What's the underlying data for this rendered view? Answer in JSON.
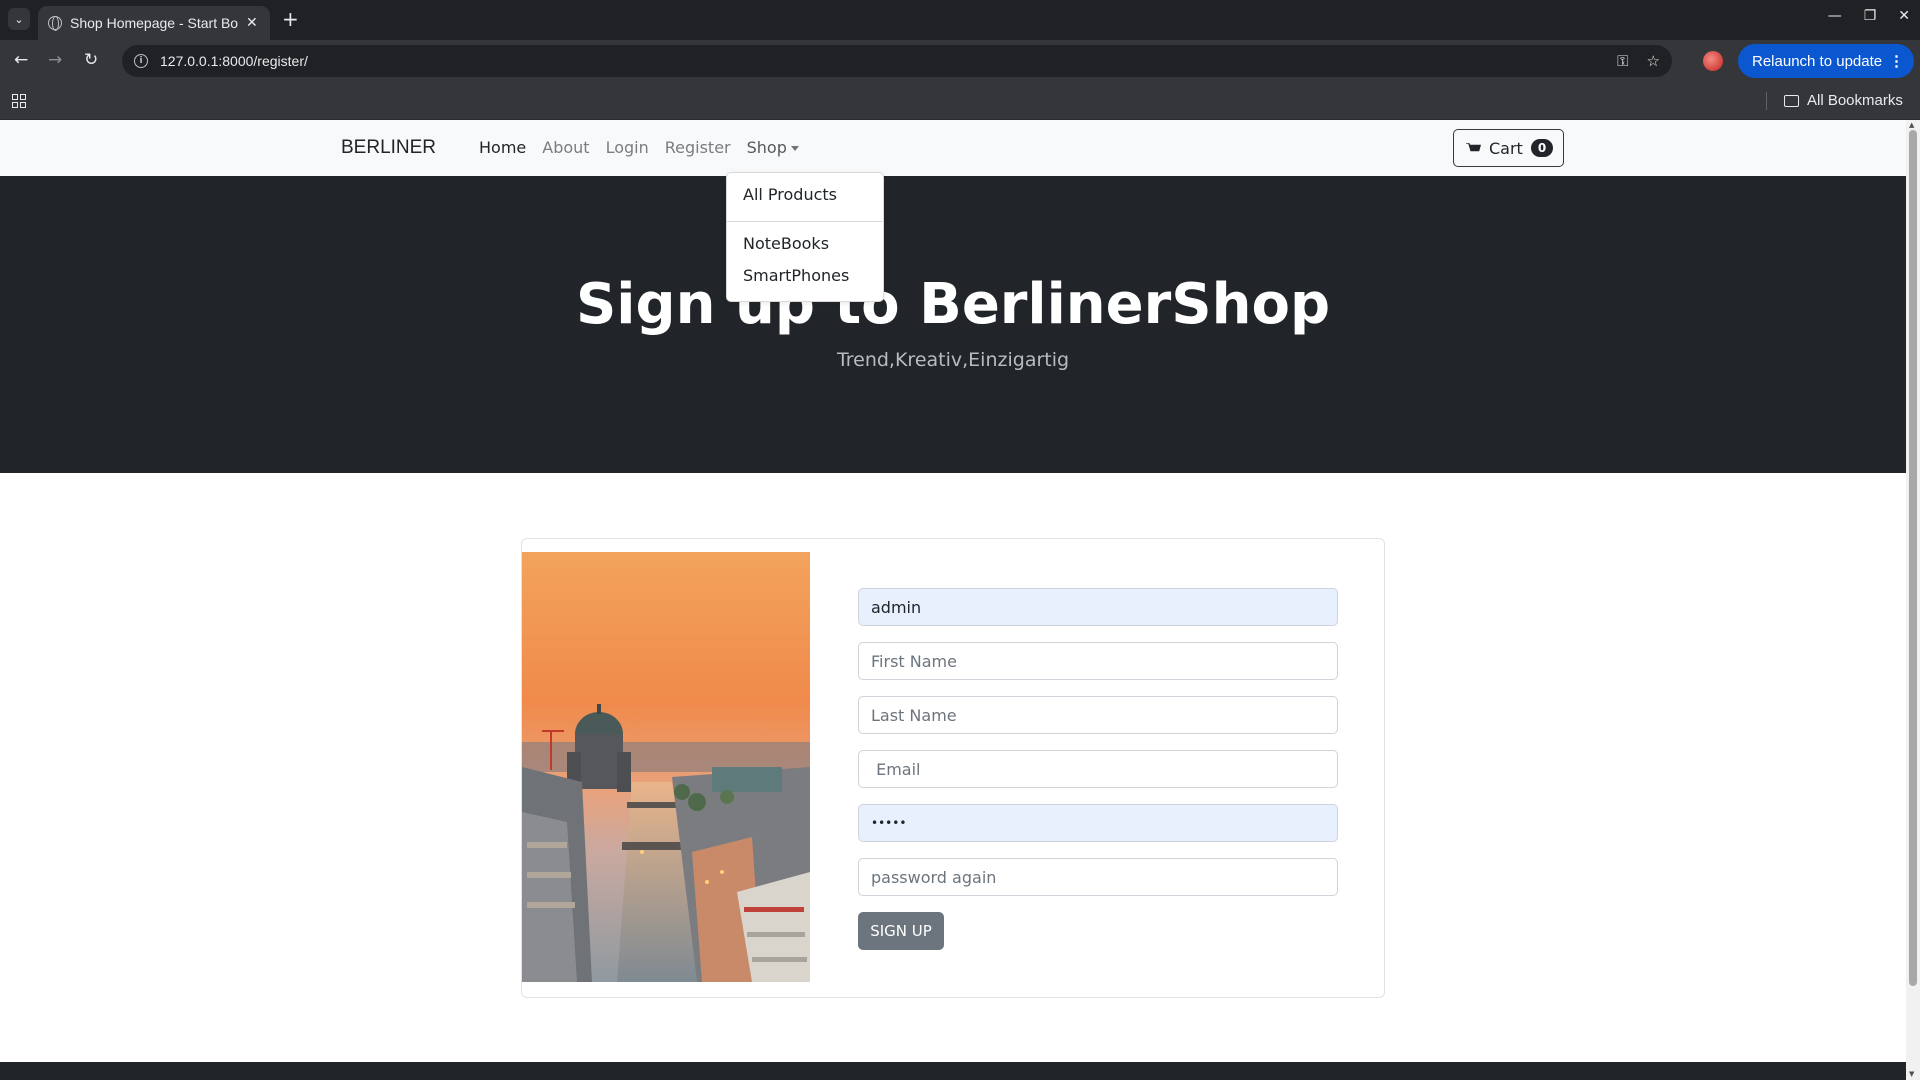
{
  "browser": {
    "tab_title": "Shop Homepage - Start Bootstrap",
    "tab_close": "✕",
    "new_tab": "+",
    "url": "127.0.0.1:8000/register/",
    "relaunch_label": "Relaunch to update",
    "all_bookmarks": "All Bookmarks"
  },
  "navbar": {
    "brand": "BERLINER",
    "links": [
      "Home",
      "About",
      "Login",
      "Register",
      "Shop"
    ],
    "cart_label": "Cart",
    "cart_count": "0"
  },
  "dropdown": {
    "items": [
      "All Products",
      "NoteBooks",
      "SmartPhones"
    ]
  },
  "hero": {
    "title": "Sign up to BerlinerShop",
    "subtitle": "Trend,Kreativ,Einzigartig"
  },
  "form": {
    "username_value": "admin",
    "first_name_placeholder": "First Name",
    "last_name_placeholder": "Last Name",
    "email_placeholder": " Email",
    "password_value": "•••••",
    "password_again_placeholder": "password again",
    "submit_label": "SIGN UP"
  },
  "colors": {
    "hero_bg": "#212529",
    "navbar_bg": "#f8f9fa",
    "autofill_bg": "#e8f0fe",
    "button_bg": "#6c757d",
    "chrome_accent": "#0b57d0"
  }
}
